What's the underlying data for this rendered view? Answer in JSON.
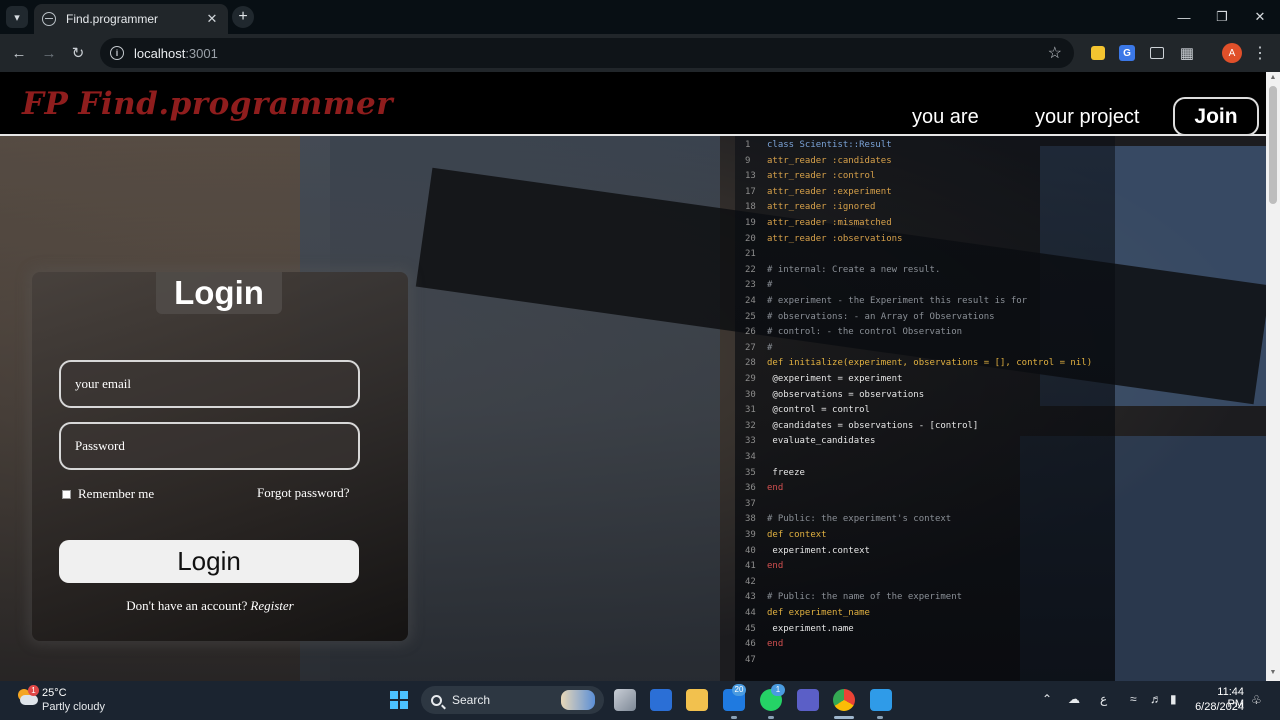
{
  "browser": {
    "tab_title": "Find.programmer",
    "url_host": "localhost",
    "url_port": ":3001",
    "profile_initial": "A",
    "translate_glyph": "G"
  },
  "site": {
    "logo_mark": "FP",
    "logo_text": "Find.programmer",
    "nav": {
      "you_are": "you are",
      "your_project": "your project",
      "join": "Join"
    }
  },
  "login": {
    "title": "Login",
    "email_placeholder": "your email",
    "password_placeholder": "Password",
    "remember_label": "Remember me",
    "forgot_label": "Forgot password?",
    "submit_label": "Login",
    "no_account_text": "Don't have an account?",
    "register_label": "Register"
  },
  "code_lines": [
    {
      "n": "1",
      "t": "class Scientist::Result",
      "c": "#7aa2d6"
    },
    {
      "n": "9",
      "t": "attr_reader :candidates",
      "c": "#d6a04a"
    },
    {
      "n": "13",
      "t": "attr_reader :control",
      "c": "#d6a04a"
    },
    {
      "n": "17",
      "t": "attr_reader :experiment",
      "c": "#d6a04a"
    },
    {
      "n": "18",
      "t": "attr_reader :ignored",
      "c": "#d6a04a"
    },
    {
      "n": "19",
      "t": "attr_reader :mismatched",
      "c": "#d6a04a"
    },
    {
      "n": "20",
      "t": "attr_reader :observations",
      "c": "#d6a04a"
    },
    {
      "n": "21",
      "t": "",
      "c": "#999"
    },
    {
      "n": "22",
      "t": "# internal: Create a new result.",
      "c": "#8a8f96"
    },
    {
      "n": "23",
      "t": "#",
      "c": "#8a8f96"
    },
    {
      "n": "24",
      "t": "# experiment   - the Experiment this result is for",
      "c": "#8a8f96"
    },
    {
      "n": "25",
      "t": "# observations: - an Array of Observations",
      "c": "#8a8f96"
    },
    {
      "n": "26",
      "t": "# control:      - the control Observation",
      "c": "#8a8f96"
    },
    {
      "n": "27",
      "t": "#",
      "c": "#8a8f96"
    },
    {
      "n": "28",
      "t": "def initialize(experiment, observations = [], control = nil)",
      "c": "#e0b040"
    },
    {
      "n": "29",
      "t": "  @experiment    = experiment",
      "c": "#e6e6e6"
    },
    {
      "n": "30",
      "t": "  @observations  = observations",
      "c": "#e6e6e6"
    },
    {
      "n": "31",
      "t": "  @control       = control",
      "c": "#e6e6e6"
    },
    {
      "n": "32",
      "t": "  @candidates    = observations - [control]",
      "c": "#e6e6e6"
    },
    {
      "n": "33",
      "t": "  evaluate_candidates",
      "c": "#e6e6e6"
    },
    {
      "n": "34",
      "t": "",
      "c": "#999"
    },
    {
      "n": "35",
      "t": "  freeze",
      "c": "#e6e6e6"
    },
    {
      "n": "36",
      "t": "end",
      "c": "#d25050"
    },
    {
      "n": "37",
      "t": "",
      "c": "#999"
    },
    {
      "n": "38",
      "t": "# Public: the experiment's context",
      "c": "#8a8f96"
    },
    {
      "n": "39",
      "t": "def context",
      "c": "#e0b040"
    },
    {
      "n": "40",
      "t": "  experiment.context",
      "c": "#e6e6e6"
    },
    {
      "n": "41",
      "t": "end",
      "c": "#d25050"
    },
    {
      "n": "42",
      "t": "",
      "c": "#999"
    },
    {
      "n": "43",
      "t": "# Public: the name of the experiment",
      "c": "#8a8f96"
    },
    {
      "n": "44",
      "t": "def experiment_name",
      "c": "#e0b040"
    },
    {
      "n": "45",
      "t": "  experiment.name",
      "c": "#e6e6e6"
    },
    {
      "n": "46",
      "t": "end",
      "c": "#d25050"
    },
    {
      "n": "47",
      "t": "",
      "c": "#999"
    }
  ],
  "taskbar": {
    "weather_temp": "25°C",
    "weather_desc": "Partly cloudy",
    "weather_badge": "1",
    "search_label": "Search",
    "mail_badge": "20",
    "whatsapp_badge": "1",
    "language": "ع",
    "time": "11:44 PM",
    "date": "6/28/2024"
  },
  "colors": {
    "logo": "#8f1d1d",
    "nav_bg": "#000000",
    "chrome_bg": "#21262a",
    "taskbar_bg": "#1b2430"
  }
}
